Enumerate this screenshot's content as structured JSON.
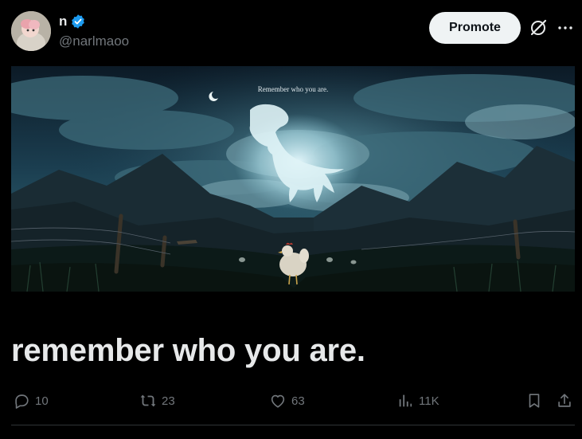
{
  "author": {
    "display_name": "n",
    "handle": "@narlmaoo",
    "verified": true
  },
  "header": {
    "promote_label": "Promote",
    "grok_icon": "grok-slash-circle-icon",
    "more_icon": "more-horizontal-icon"
  },
  "media": {
    "caption": "Remember who you are."
  },
  "tweet": {
    "text": "remember who you are."
  },
  "actions": {
    "replies": "10",
    "reposts": "23",
    "likes": "63",
    "views": "11K"
  },
  "colors": {
    "background": "#000000",
    "text_primary": "#e7e9ea",
    "text_secondary": "#71767b",
    "verified_blue": "#1d9bf0",
    "promote_bg": "#eff3f4"
  }
}
